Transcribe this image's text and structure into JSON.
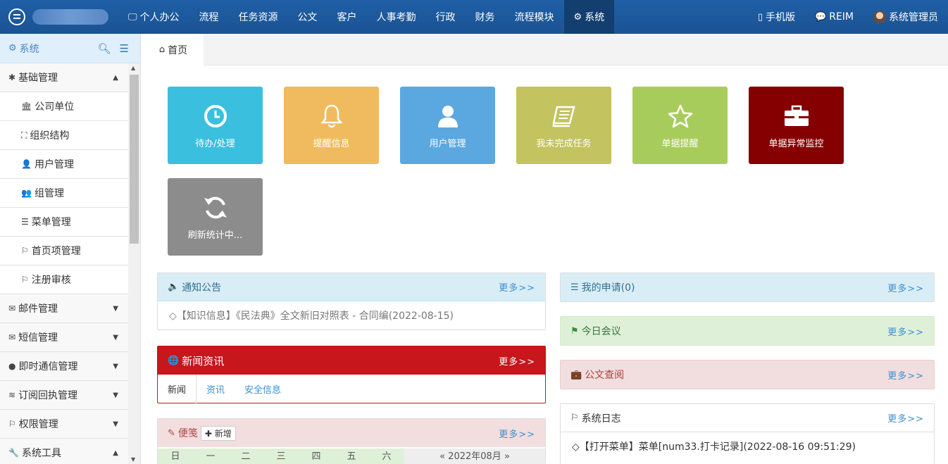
{
  "nav": {
    "items": [
      "个人办公",
      "流程",
      "任务资源",
      "公文",
      "客户",
      "人事考勤",
      "行政",
      "财务",
      "流程模块",
      "系统"
    ],
    "right": [
      "手机版",
      "REIM",
      "系统管理员"
    ]
  },
  "sidebar": {
    "title": "系统",
    "items": [
      {
        "label": "基础管理",
        "type": "group",
        "icon": "asterisk-icon",
        "caret": "▲"
      },
      {
        "label": "公司单位",
        "type": "sub",
        "icon": "building-icon"
      },
      {
        "label": "组织结构",
        "type": "sub",
        "icon": "sitemap-icon"
      },
      {
        "label": "用户管理",
        "type": "sub",
        "icon": "user-icon"
      },
      {
        "label": "组管理",
        "type": "sub",
        "icon": "users-icon"
      },
      {
        "label": "菜单管理",
        "type": "sub",
        "icon": "list-icon"
      },
      {
        "label": "首页项管理",
        "type": "sub",
        "icon": "bookmark-icon"
      },
      {
        "label": "注册审核",
        "type": "sub",
        "icon": "bookmark-icon"
      },
      {
        "label": "邮件管理",
        "type": "group",
        "icon": "envelope-icon",
        "caret": "▼"
      },
      {
        "label": "短信管理",
        "type": "group",
        "icon": "envelope-o-icon",
        "caret": "▼"
      },
      {
        "label": "即时通信管理",
        "type": "group",
        "icon": "comment-icon",
        "caret": "▼"
      },
      {
        "label": "订阅回执管理",
        "type": "group",
        "icon": "rss-icon",
        "caret": "▼"
      },
      {
        "label": "权限管理",
        "type": "group",
        "icon": "bookmark-icon",
        "caret": "▼"
      },
      {
        "label": "系统工具",
        "type": "group",
        "icon": "wrench-icon",
        "caret": "▲"
      }
    ]
  },
  "tab": {
    "label": "首页"
  },
  "tiles": [
    {
      "label": "待办/处理",
      "color": "#3bbfdf",
      "icon": "clock-icon"
    },
    {
      "label": "提醒信息",
      "color": "#f0bb5f",
      "icon": "bell-icon"
    },
    {
      "label": "用户管理",
      "color": "#5ba8e0",
      "icon": "user-icon"
    },
    {
      "label": "我未完成任务",
      "color": "#c3c360",
      "icon": "book-icon"
    },
    {
      "label": "单据提醒",
      "color": "#a8cc5c",
      "icon": "star-icon"
    },
    {
      "label": "单据异常监控",
      "color": "#850000",
      "icon": "briefcase-icon"
    },
    {
      "label": "刷新统计中...",
      "color": "#8c8c8c",
      "icon": "refresh-icon"
    }
  ],
  "panels": {
    "notice": {
      "title": "通知公告",
      "more": "更多>>",
      "row": "◇【知识信息】《民法典》全文新旧对照表 - 合同编(2022-08-15)"
    },
    "news": {
      "title": "新闻资讯",
      "more": "更多>>",
      "tabs": [
        "新闻",
        "资讯",
        "安全信息"
      ]
    },
    "memo": {
      "title": "便笺",
      "add": "新增",
      "more": "更多>>",
      "weekdays": [
        "日",
        "一",
        "二",
        "三",
        "四",
        "五",
        "六"
      ],
      "month": "« 2022年08月 »"
    },
    "apply": {
      "title": "我的申请(0)",
      "more": "更多>>"
    },
    "meeting": {
      "title": "今日会议",
      "more": "更多>>"
    },
    "docs": {
      "title": "公文查阅",
      "more": "更多>>"
    },
    "syslog": {
      "title": "系统日志",
      "more": "更多>>",
      "row": "◇【打开菜单】菜单[num33.打卡记录](2022-08-16 09:51:29)"
    }
  }
}
